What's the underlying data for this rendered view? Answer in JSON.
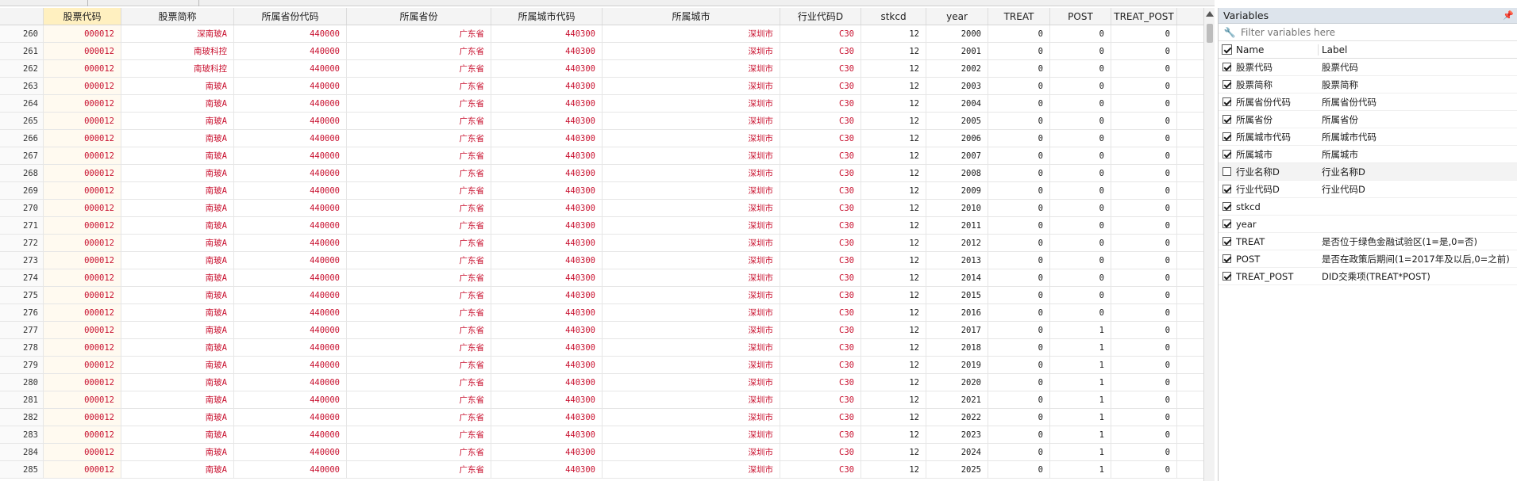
{
  "grid": {
    "columns": [
      "",
      "股票代码",
      "股票简称",
      "所属省份代码",
      "所属省份",
      "所属城市代码",
      "所属城市",
      "行业代码D",
      "stkcd",
      "year",
      "TREAT",
      "POST",
      "TREAT_POST"
    ],
    "rows": [
      [
        "260",
        "000012",
        "深南玻A",
        "440000",
        "广东省",
        "440300",
        "深圳市",
        "C30",
        "12",
        "2000",
        "0",
        "0",
        "0"
      ],
      [
        "261",
        "000012",
        "南玻科控",
        "440000",
        "广东省",
        "440300",
        "深圳市",
        "C30",
        "12",
        "2001",
        "0",
        "0",
        "0"
      ],
      [
        "262",
        "000012",
        "南玻科控",
        "440000",
        "广东省",
        "440300",
        "深圳市",
        "C30",
        "12",
        "2002",
        "0",
        "0",
        "0"
      ],
      [
        "263",
        "000012",
        "南玻A",
        "440000",
        "广东省",
        "440300",
        "深圳市",
        "C30",
        "12",
        "2003",
        "0",
        "0",
        "0"
      ],
      [
        "264",
        "000012",
        "南玻A",
        "440000",
        "广东省",
        "440300",
        "深圳市",
        "C30",
        "12",
        "2004",
        "0",
        "0",
        "0"
      ],
      [
        "265",
        "000012",
        "南玻A",
        "440000",
        "广东省",
        "440300",
        "深圳市",
        "C30",
        "12",
        "2005",
        "0",
        "0",
        "0"
      ],
      [
        "266",
        "000012",
        "南玻A",
        "440000",
        "广东省",
        "440300",
        "深圳市",
        "C30",
        "12",
        "2006",
        "0",
        "0",
        "0"
      ],
      [
        "267",
        "000012",
        "南玻A",
        "440000",
        "广东省",
        "440300",
        "深圳市",
        "C30",
        "12",
        "2007",
        "0",
        "0",
        "0"
      ],
      [
        "268",
        "000012",
        "南玻A",
        "440000",
        "广东省",
        "440300",
        "深圳市",
        "C30",
        "12",
        "2008",
        "0",
        "0",
        "0"
      ],
      [
        "269",
        "000012",
        "南玻A",
        "440000",
        "广东省",
        "440300",
        "深圳市",
        "C30",
        "12",
        "2009",
        "0",
        "0",
        "0"
      ],
      [
        "270",
        "000012",
        "南玻A",
        "440000",
        "广东省",
        "440300",
        "深圳市",
        "C30",
        "12",
        "2010",
        "0",
        "0",
        "0"
      ],
      [
        "271",
        "000012",
        "南玻A",
        "440000",
        "广东省",
        "440300",
        "深圳市",
        "C30",
        "12",
        "2011",
        "0",
        "0",
        "0"
      ],
      [
        "272",
        "000012",
        "南玻A",
        "440000",
        "广东省",
        "440300",
        "深圳市",
        "C30",
        "12",
        "2012",
        "0",
        "0",
        "0"
      ],
      [
        "273",
        "000012",
        "南玻A",
        "440000",
        "广东省",
        "440300",
        "深圳市",
        "C30",
        "12",
        "2013",
        "0",
        "0",
        "0"
      ],
      [
        "274",
        "000012",
        "南玻A",
        "440000",
        "广东省",
        "440300",
        "深圳市",
        "C30",
        "12",
        "2014",
        "0",
        "0",
        "0"
      ],
      [
        "275",
        "000012",
        "南玻A",
        "440000",
        "广东省",
        "440300",
        "深圳市",
        "C30",
        "12",
        "2015",
        "0",
        "0",
        "0"
      ],
      [
        "276",
        "000012",
        "南玻A",
        "440000",
        "广东省",
        "440300",
        "深圳市",
        "C30",
        "12",
        "2016",
        "0",
        "0",
        "0"
      ],
      [
        "277",
        "000012",
        "南玻A",
        "440000",
        "广东省",
        "440300",
        "深圳市",
        "C30",
        "12",
        "2017",
        "0",
        "1",
        "0"
      ],
      [
        "278",
        "000012",
        "南玻A",
        "440000",
        "广东省",
        "440300",
        "深圳市",
        "C30",
        "12",
        "2018",
        "0",
        "1",
        "0"
      ],
      [
        "279",
        "000012",
        "南玻A",
        "440000",
        "广东省",
        "440300",
        "深圳市",
        "C30",
        "12",
        "2019",
        "0",
        "1",
        "0"
      ],
      [
        "280",
        "000012",
        "南玻A",
        "440000",
        "广东省",
        "440300",
        "深圳市",
        "C30",
        "12",
        "2020",
        "0",
        "1",
        "0"
      ],
      [
        "281",
        "000012",
        "南玻A",
        "440000",
        "广东省",
        "440300",
        "深圳市",
        "C30",
        "12",
        "2021",
        "0",
        "1",
        "0"
      ],
      [
        "282",
        "000012",
        "南玻A",
        "440000",
        "广东省",
        "440300",
        "深圳市",
        "C30",
        "12",
        "2022",
        "0",
        "1",
        "0"
      ],
      [
        "283",
        "000012",
        "南玻A",
        "440000",
        "广东省",
        "440300",
        "深圳市",
        "C30",
        "12",
        "2023",
        "0",
        "1",
        "0"
      ],
      [
        "284",
        "000012",
        "南玻A",
        "440000",
        "广东省",
        "440300",
        "深圳市",
        "C30",
        "12",
        "2024",
        "0",
        "1",
        "0"
      ],
      [
        "285",
        "000012",
        "南玻A",
        "440000",
        "广东省",
        "440300",
        "深圳市",
        "C30",
        "12",
        "2025",
        "0",
        "1",
        "0"
      ]
    ],
    "string_color": "#c8102e",
    "selected_column_color": "#fff0c0"
  },
  "variables": {
    "title": "Variables",
    "pin_icon": "pin-icon",
    "filter_placeholder": "Filter variables here",
    "header_name": "Name",
    "header_label": "Label",
    "items": [
      {
        "name": "股票代码",
        "label": "股票代码",
        "checked": true
      },
      {
        "name": "股票简称",
        "label": "股票简称",
        "checked": true
      },
      {
        "name": "所属省份代码",
        "label": "所属省份代码",
        "checked": true
      },
      {
        "name": "所属省份",
        "label": "所属省份",
        "checked": true
      },
      {
        "name": "所属城市代码",
        "label": "所属城市代码",
        "checked": true
      },
      {
        "name": "所属城市",
        "label": "所属城市",
        "checked": true
      },
      {
        "name": "行业名称D",
        "label": "行业名称D",
        "checked": false
      },
      {
        "name": "行业代码D",
        "label": "行业代码D",
        "checked": true
      },
      {
        "name": "stkcd",
        "label": "",
        "checked": true
      },
      {
        "name": "year",
        "label": "",
        "checked": true
      },
      {
        "name": "TREAT",
        "label": "是否位于绿色金融试验区(1=是,0=否)",
        "checked": true
      },
      {
        "name": "POST",
        "label": "是否在政策后期间(1=2017年及以后,0=之前)",
        "checked": true
      },
      {
        "name": "TREAT_POST",
        "label": "DID交乘项(TREAT*POST)",
        "checked": true
      }
    ]
  }
}
